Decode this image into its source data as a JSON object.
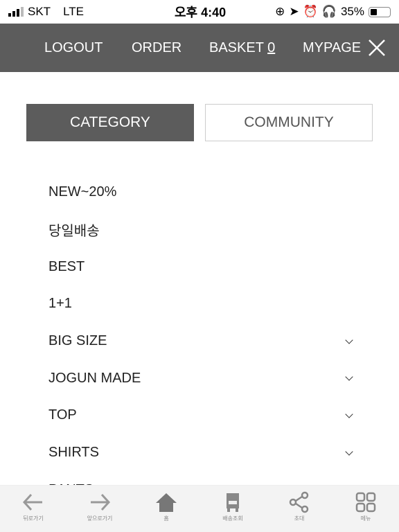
{
  "status_bar": {
    "carrier": "SKT",
    "network": "LTE",
    "time": "오후 4:40",
    "battery": "35%",
    "battery_level": 0.35
  },
  "nav": {
    "logout": "LOGOUT",
    "order": "ORDER",
    "basket": "BASKET",
    "basket_count": "0",
    "mypage": "MYPAGE"
  },
  "tabs": {
    "category": "CATEGORY",
    "community": "COMMUNITY"
  },
  "menu": [
    {
      "label": "NEW~20%",
      "expandable": false
    },
    {
      "label": "당일배송",
      "expandable": false
    },
    {
      "label": "BEST",
      "expandable": false
    },
    {
      "label": "1+1",
      "expandable": false
    },
    {
      "label": "BIG SIZE",
      "expandable": true
    },
    {
      "label": "JOGUN MADE",
      "expandable": true
    },
    {
      "label": "TOP",
      "expandable": true
    },
    {
      "label": "SHIRTS",
      "expandable": true
    },
    {
      "label": "PANTS",
      "expandable": true
    }
  ],
  "bottom_bar": [
    {
      "label": "뒤로가기",
      "icon": "back-arrow-icon"
    },
    {
      "label": "앞으로가기",
      "icon": "forward-arrow-icon"
    },
    {
      "label": "홈",
      "icon": "home-icon"
    },
    {
      "label": "배송조회",
      "icon": "truck-icon"
    },
    {
      "label": "초대",
      "icon": "share-icon"
    },
    {
      "label": "메뉴",
      "icon": "grid-icon"
    }
  ]
}
